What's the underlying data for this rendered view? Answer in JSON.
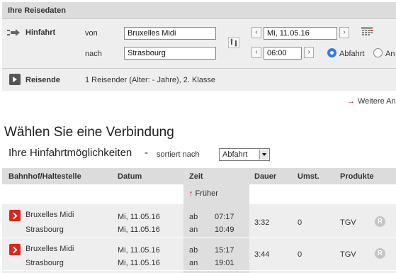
{
  "travel_box": {
    "title": "Ihre Reisedaten",
    "outbound_label": "Hinfahrt",
    "from_label": "von",
    "to_label": "nach",
    "from_value": "Bruxelles Midi",
    "to_value": "Strasbourg",
    "date_value": "Mi, 11.05.16",
    "time_value": "06:00",
    "radio_departure_label": "Abfahrt",
    "radio_arrival_label": "An",
    "radio_selected": "Abfahrt",
    "travellers_label": "Reisende",
    "travellers_value": "1 Reisender (Alter: - Jahre), 2. Klasse"
  },
  "more_link": "Weitere An",
  "heading": "Wählen Sie eine Verbindung",
  "subheading": "Ihre Hinfahrtmöglichkeiten",
  "subheading_dash": "-",
  "sort": {
    "label": "sortiert nach",
    "value": "Abfahrt"
  },
  "table": {
    "headers": {
      "station": "Bahnhof/Haltestelle",
      "date": "Datum",
      "time": "Zeit",
      "duration": "Dauer",
      "changes": "Umst.",
      "products": "Produkte"
    },
    "earlier_label": "Früher",
    "rows": [
      {
        "from": "Bruxelles Midi",
        "to": "Strasbourg",
        "date_from": "Mi, 11.05.16",
        "date_to": "Mi, 11.05.16",
        "dep_label": "ab",
        "arr_label": "an",
        "dep_time": "07:17",
        "arr_time": "10:49",
        "duration": "3:32",
        "changes": "0",
        "product": "TGV",
        "badge": "R"
      },
      {
        "from": "Bruxelles Midi",
        "to": "Strasbourg",
        "date_from": "Mi, 11.05.16",
        "date_to": "Mi, 11.05.16",
        "dep_label": "ab",
        "arr_label": "an",
        "dep_time": "15:17",
        "arr_time": "19:01",
        "duration": "3:44",
        "changes": "0",
        "product": "TGV",
        "badge": "R"
      }
    ]
  },
  "colors": {
    "accent_red": "#e2231a",
    "radio_blue": "#2f7be8",
    "header_gray": "#dcdcdc",
    "panel_gray": "#eeeeee"
  },
  "icons": [
    "direction-arrow-icon",
    "swap-icon",
    "calendar-icon",
    "chevron-right-icon",
    "train-icon",
    "reservation-icon"
  ]
}
